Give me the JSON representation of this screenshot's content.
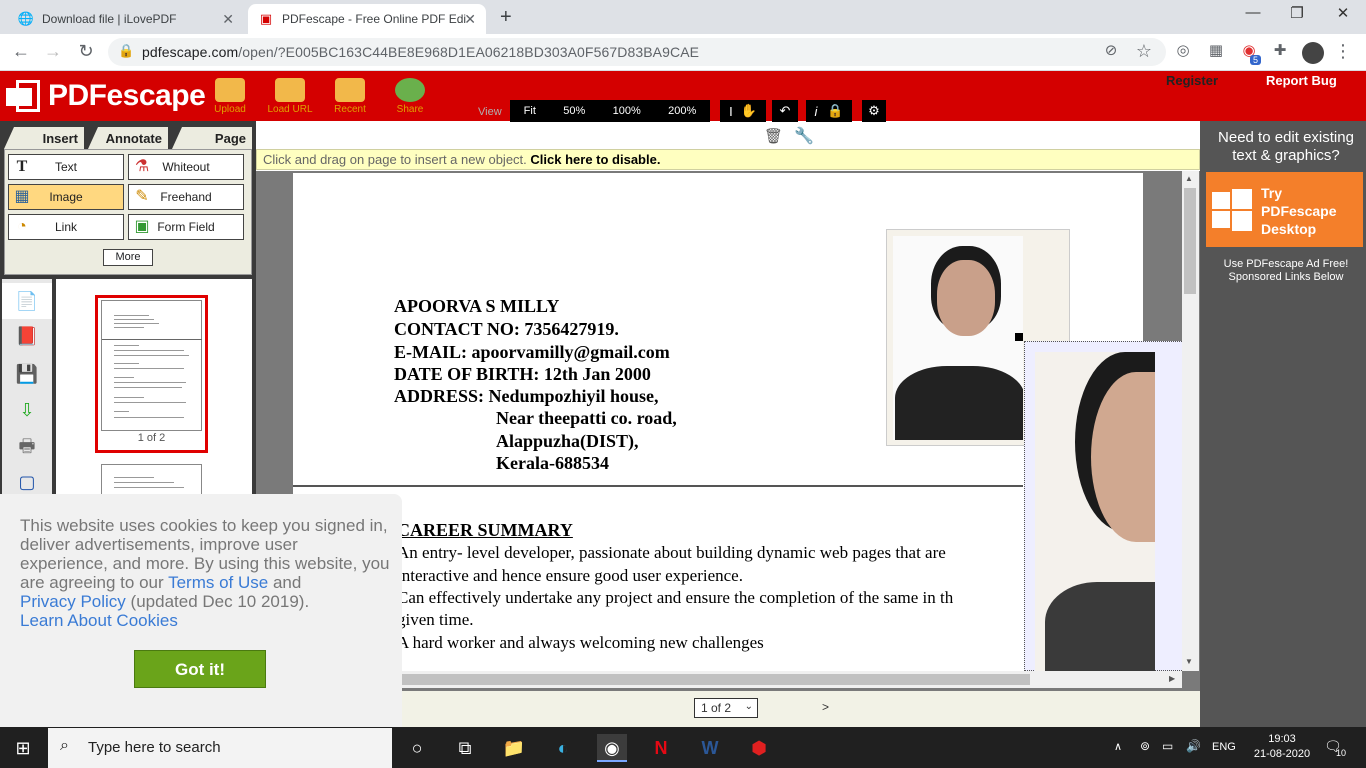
{
  "browser": {
    "tabs": [
      {
        "title": "Download file | iLovePDF"
      },
      {
        "title": "PDFescape - Free Online PDF Edi"
      }
    ],
    "url_host": "pdfescape.com",
    "url_path": "/open/?E005BC163C44BE8E968D1EA06218BD303A0F567D83BA9CAE",
    "extension_badge": "5"
  },
  "app": {
    "logo": "PDFescape",
    "header_buttons": [
      "Upload",
      "Load URL",
      "Recent",
      "Share"
    ],
    "view_label": "View",
    "zoom_options": [
      "Fit",
      "50%",
      "100%",
      "200%"
    ],
    "register": "Register",
    "report_bug": "Report Bug",
    "panel_tabs": [
      "Insert",
      "Annotate",
      "Page"
    ],
    "tools": [
      {
        "label": "Text",
        "icon": "text-icon"
      },
      {
        "label": "Whiteout",
        "icon": "whiteout-icon"
      },
      {
        "label": "Image",
        "icon": "image-icon"
      },
      {
        "label": "Freehand",
        "icon": "pencil-icon"
      },
      {
        "label": "Link",
        "icon": "link-icon"
      },
      {
        "label": "Form Field",
        "icon": "form-field-icon"
      }
    ],
    "more": "More",
    "thumb_label": "1 of 2",
    "hint_text": "Click and drag on page to insert a new object.",
    "hint_action": "Click here to disable.",
    "page_select": "1 of 2",
    "next_page": ">"
  },
  "document": {
    "name": "APOORVA S MILLY",
    "contact": "CONTACT NO: 7356427919.",
    "email": "E-MAIL: apoorvamilly@gmail.com",
    "dob": "DATE OF BIRTH: 12th Jan 2000",
    "address_label": "ADDRESS: Nedumpozhiyil house,",
    "address2": "Near theepatti co. road,",
    "address3": "Alappuzha(DIST),",
    "address4": "Kerala-688534",
    "section": "CAREER SUMMARY",
    "line1": "An entry- level developer, passionate about building dynamic web pages that are",
    "line2": "interactive and hence ensure good user experience.",
    "line3": "Can effectively undertake any project and ensure the completion of the same in th",
    "line4": "given time.",
    "line5": "A hard worker and always welcoming new challenges"
  },
  "ad": {
    "need_edit": "Need to edit existing text & graphics?",
    "try": "Try",
    "product": "PDFescape",
    "desktop": "Desktop",
    "adfree": "Use PDFescape Ad Free!",
    "sponsored": "Sponsored Links Below"
  },
  "cookie": {
    "text1": "This website uses cookies to keep you signed in, deliver advertisements, improve user experience, and more. By using this website, you are agreeing to our",
    "terms": "Terms of Use",
    "and": "and",
    "privacy": "Privacy Policy",
    "updated": "(updated Dec 10 2019).",
    "learn": "Learn About Cookies",
    "button": "Got it!"
  },
  "taskbar": {
    "search_placeholder": "Type here to search",
    "lang": "ENG",
    "time": "19:03",
    "date": "21-08-2020",
    "notifications": "10"
  },
  "colors": {
    "brand_red": "#d40000",
    "accent_orange": "#f47f2a",
    "got_it_green": "#6aa41a"
  }
}
